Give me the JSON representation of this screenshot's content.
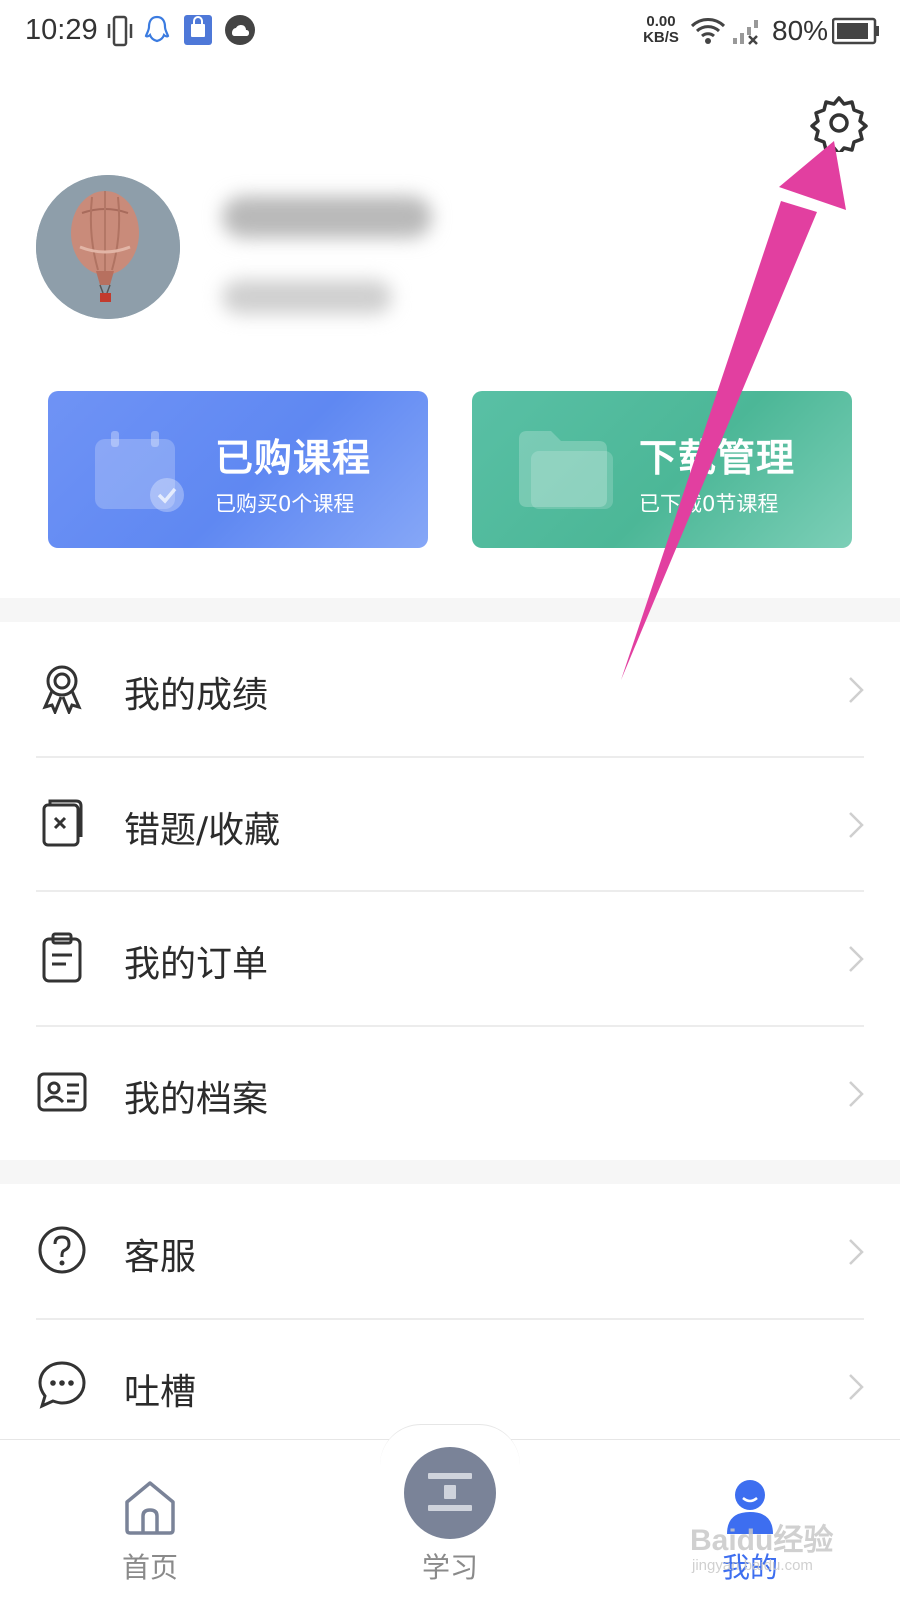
{
  "status_bar": {
    "time": "10:29",
    "net_speed_value": "0.00",
    "net_speed_unit": "KB/S",
    "battery_percent": "80%",
    "left_icons": [
      "vibrate-icon",
      "qq-icon",
      "shopping-bag-icon",
      "cloud-icon"
    ],
    "right_icons": [
      "wifi-icon",
      "no-signal-icon",
      "battery-icon"
    ]
  },
  "header": {
    "settings_icon": "gear-icon"
  },
  "cards": [
    {
      "title": "已购课程",
      "subtitle": "已购买0个课程",
      "icon": "calendar-check-icon",
      "color": "#6a90f4"
    },
    {
      "title": "下载管理",
      "subtitle": "已下载0节课程",
      "icon": "folder-icon",
      "color": "#53bc9f"
    }
  ],
  "menu": {
    "group1": [
      {
        "label": "我的成绩",
        "icon": "award-ribbon-icon"
      },
      {
        "label": "错题/收藏",
        "icon": "wrong-bookmark-icon"
      },
      {
        "label": "我的订单",
        "icon": "clipboard-icon"
      },
      {
        "label": "我的档案",
        "icon": "id-card-icon"
      }
    ],
    "group2": [
      {
        "label": "客服",
        "icon": "question-circle-icon"
      },
      {
        "label": "吐槽",
        "icon": "chat-bubble-icon"
      }
    ]
  },
  "bottom_nav": [
    {
      "label": "首页",
      "icon": "home-icon",
      "active": false
    },
    {
      "label": "学习",
      "icon": "study-icon",
      "active": false
    },
    {
      "label": "我的",
      "icon": "person-icon",
      "active": true
    }
  ],
  "colors": {
    "accent_blue": "#3d6ef0",
    "annotation_pink": "#e23fa0",
    "nav_inactive": "#8a8a8a"
  },
  "watermark": {
    "text": "Baidu经验",
    "sub": "jingyan.baidu.com"
  }
}
